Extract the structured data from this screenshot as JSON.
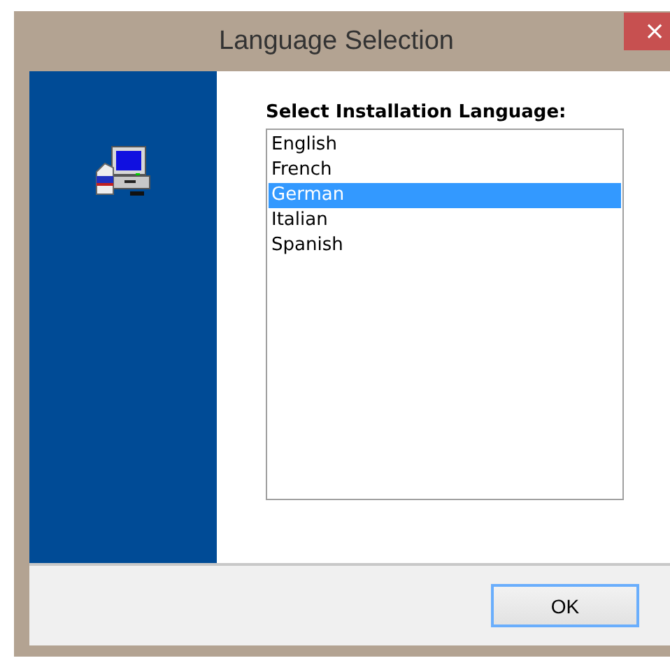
{
  "window": {
    "title": "Language Selection",
    "close": "×"
  },
  "prompt": "Select Installation Language:",
  "languages": [
    {
      "label": "English",
      "selected": false
    },
    {
      "label": "French",
      "selected": false
    },
    {
      "label": "German",
      "selected": true
    },
    {
      "label": "Italian",
      "selected": false
    },
    {
      "label": "Spanish",
      "selected": false
    }
  ],
  "buttons": [
    "OK"
  ]
}
